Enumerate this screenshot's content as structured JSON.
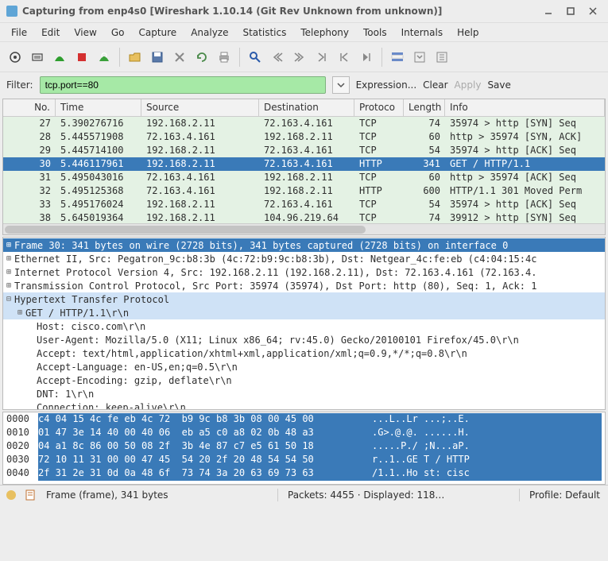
{
  "window": {
    "title": "Capturing from enp4s0    [Wireshark 1.10.14  (Git Rev Unknown from unknown)]"
  },
  "menubar": [
    "File",
    "Edit",
    "View",
    "Go",
    "Capture",
    "Analyze",
    "Statistics",
    "Telephony",
    "Tools",
    "Internals",
    "Help"
  ],
  "filter": {
    "label": "Filter:",
    "value": "tcp.port==80",
    "expression": "Expression...",
    "clear": "Clear",
    "apply": "Apply",
    "save": "Save"
  },
  "columns": [
    "No.",
    "Time",
    "Source",
    "Destination",
    "Protoco",
    "Length",
    "Info"
  ],
  "packets": [
    {
      "no": "27",
      "time": "5.390276716",
      "src": "192.168.2.11",
      "dst": "72.163.4.161",
      "proto": "TCP",
      "len": "74",
      "info": "35974 > http [SYN] Seq",
      "bg": "#e4f2e4"
    },
    {
      "no": "28",
      "time": "5.445571908",
      "src": "72.163.4.161",
      "dst": "192.168.2.11",
      "proto": "TCP",
      "len": "60",
      "info": "http > 35974 [SYN, ACK]",
      "bg": "#e4f2e4"
    },
    {
      "no": "29",
      "time": "5.445714100",
      "src": "192.168.2.11",
      "dst": "72.163.4.161",
      "proto": "TCP",
      "len": "54",
      "info": "35974 > http [ACK] Seq",
      "bg": "#e4f2e4"
    },
    {
      "no": "30",
      "time": "5.446117961",
      "src": "192.168.2.11",
      "dst": "72.163.4.161",
      "proto": "HTTP",
      "len": "341",
      "info": "GET / HTTP/1.1",
      "sel": true
    },
    {
      "no": "31",
      "time": "5.495043016",
      "src": "72.163.4.161",
      "dst": "192.168.2.11",
      "proto": "TCP",
      "len": "60",
      "info": "http > 35974 [ACK] Seq",
      "bg": "#e4f2e4"
    },
    {
      "no": "32",
      "time": "5.495125368",
      "src": "72.163.4.161",
      "dst": "192.168.2.11",
      "proto": "HTTP",
      "len": "600",
      "info": "HTTP/1.1 301 Moved Perm",
      "bg": "#e4f2e4"
    },
    {
      "no": "33",
      "time": "5.495176024",
      "src": "192.168.2.11",
      "dst": "72.163.4.161",
      "proto": "TCP",
      "len": "54",
      "info": "35974 > http [ACK] Seq",
      "bg": "#e4f2e4"
    },
    {
      "no": "38",
      "time": "5.645019364",
      "src": "192.168.2.11",
      "dst": "104.96.219.64",
      "proto": "TCP",
      "len": "74",
      "info": "39912 > http [SYN] Seq",
      "bg": "#e4f2e4"
    }
  ],
  "details": [
    {
      "lvl": 0,
      "tw": "⊞",
      "txt": "Frame 30: 341 bytes on wire (2728 bits), 341 bytes captured (2728 bits) on interface 0",
      "sel": true
    },
    {
      "lvl": 0,
      "tw": "⊞",
      "txt": "Ethernet II, Src: Pegatron_9c:b8:3b (4c:72:b9:9c:b8:3b), Dst: Netgear_4c:fe:eb (c4:04:15:4c"
    },
    {
      "lvl": 0,
      "tw": "⊞",
      "txt": "Internet Protocol Version 4, Src: 192.168.2.11 (192.168.2.11), Dst: 72.163.4.161 (72.163.4."
    },
    {
      "lvl": 0,
      "tw": "⊞",
      "txt": "Transmission Control Protocol, Src Port: 35974 (35974), Dst Port: http (80), Seq: 1, Ack: 1"
    },
    {
      "lvl": 0,
      "tw": "⊟",
      "txt": "Hypertext Transfer Protocol",
      "hl": true
    },
    {
      "lvl": 1,
      "tw": "⊞",
      "txt": "GET / HTTP/1.1\\r\\n",
      "hl": true
    },
    {
      "lvl": 2,
      "tw": "",
      "txt": "Host: cisco.com\\r\\n"
    },
    {
      "lvl": 2,
      "tw": "",
      "txt": "User-Agent: Mozilla/5.0 (X11; Linux x86_64; rv:45.0) Gecko/20100101 Firefox/45.0\\r\\n"
    },
    {
      "lvl": 2,
      "tw": "",
      "txt": "Accept: text/html,application/xhtml+xml,application/xml;q=0.9,*/*;q=0.8\\r\\n"
    },
    {
      "lvl": 2,
      "tw": "",
      "txt": "Accept-Language: en-US,en;q=0.5\\r\\n"
    },
    {
      "lvl": 2,
      "tw": "",
      "txt": "Accept-Encoding: gzip, deflate\\r\\n"
    },
    {
      "lvl": 2,
      "tw": "",
      "txt": "DNT: 1\\r\\n"
    },
    {
      "lvl": 2,
      "tw": "",
      "txt": "Connection: keep-alive\\r\\n"
    }
  ],
  "hex": [
    {
      "off": "0000",
      "b": "c4 04 15 4c fe eb 4c 72  b9 9c b8 3b 08 00 45 00",
      "a": "...L..Lr ...;..E.",
      "sel": true
    },
    {
      "off": "0010",
      "b": "01 47 3e 14 40 00 40 06  eb a5 c0 a8 02 0b 48 a3",
      "a": ".G>.@.@. ......H.",
      "sel": true
    },
    {
      "off": "0020",
      "b": "04 a1 8c 86 00 50 08 2f  3b 4e 87 c7 e5 61 50 18",
      "a": ".....P./ ;N...aP.",
      "sel": true
    },
    {
      "off": "0030",
      "b": "72 10 11 31 00 00 47 45  54 20 2f 20 48 54 54 50",
      "a": "r..1..GE T / HTTP",
      "sel": true
    },
    {
      "off": "0040",
      "b": "2f 31 2e 31 0d 0a 48 6f  73 74 3a 20 63 69 73 63",
      "a": "/1.1..Ho st: cisc",
      "sel": true
    }
  ],
  "status": {
    "frame": "Frame (frame), 341 bytes",
    "packets": "Packets: 4455 · Displayed: 118…",
    "profile": "Profile: Default"
  }
}
